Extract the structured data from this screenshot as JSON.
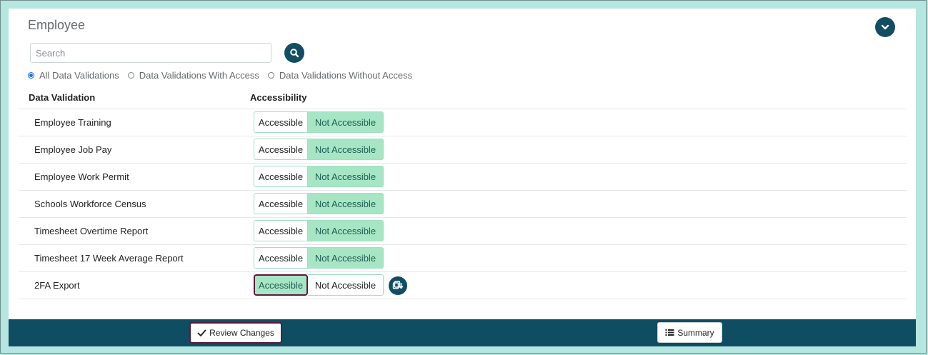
{
  "section": {
    "title": "Employee"
  },
  "search": {
    "placeholder": "Search",
    "value": ""
  },
  "filters": [
    {
      "label": "All Data Validations",
      "checked": true
    },
    {
      "label": "Data Validations With Access",
      "checked": false
    },
    {
      "label": "Data Validations Without Access",
      "checked": false
    }
  ],
  "table": {
    "columns": [
      "Data Validation",
      "Accessibility"
    ],
    "toggle_labels": {
      "accessible": "Accessible",
      "not_accessible": "Not Accessible"
    },
    "rows": [
      {
        "name": "Employee Training",
        "selected": "not_accessible"
      },
      {
        "name": "Employee Job Pay",
        "selected": "not_accessible"
      },
      {
        "name": "Employee Work Permit",
        "selected": "not_accessible"
      },
      {
        "name": "Schools Workforce Census",
        "selected": "not_accessible"
      },
      {
        "name": "Timesheet Overtime Report",
        "selected": "not_accessible"
      },
      {
        "name": "Timesheet 17 Week Average Report",
        "selected": "not_accessible"
      },
      {
        "name": "2FA Export",
        "selected": "accessible"
      }
    ]
  },
  "footer": {
    "review_label": "Review Changes",
    "summary_label": "Summary"
  },
  "colors": {
    "primary": "#114d63",
    "active_toggle": "#a7e6c5",
    "focus_ring": "#5c1a3c",
    "page_background": "#b5e6df"
  }
}
